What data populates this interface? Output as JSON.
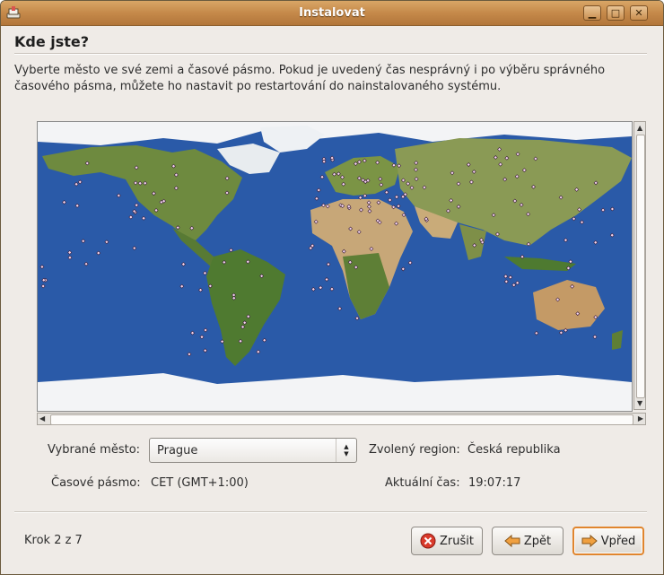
{
  "window": {
    "title": "Instalovat"
  },
  "page": {
    "heading": "Kde jste?",
    "description": "Vyberte město ve své zemi a časové pásmo. Pokud je uvedený čas nesprávný i po výběru správného časového pásma, můžete ho nastavit po restartování do nainstalovaného systému."
  },
  "form": {
    "city_label": "Vybrané město:",
    "city_value": "Prague",
    "region_label": "Zvolený region:",
    "region_value": "Česká republika",
    "timezone_label": "Časové pásmo:",
    "timezone_value": "CET (GMT+1:00)",
    "time_label": "Aktuální čas:",
    "time_value": "19:07:17"
  },
  "footer": {
    "step": "Krok 2 z 7",
    "cancel_label": "Zrušit",
    "back_label": "Zpět",
    "forward_label": "Vpřed"
  },
  "colors": {
    "ocean": "#2a5aa8",
    "titlebar": "#c5894a",
    "default_button_border": "#e0852e"
  }
}
